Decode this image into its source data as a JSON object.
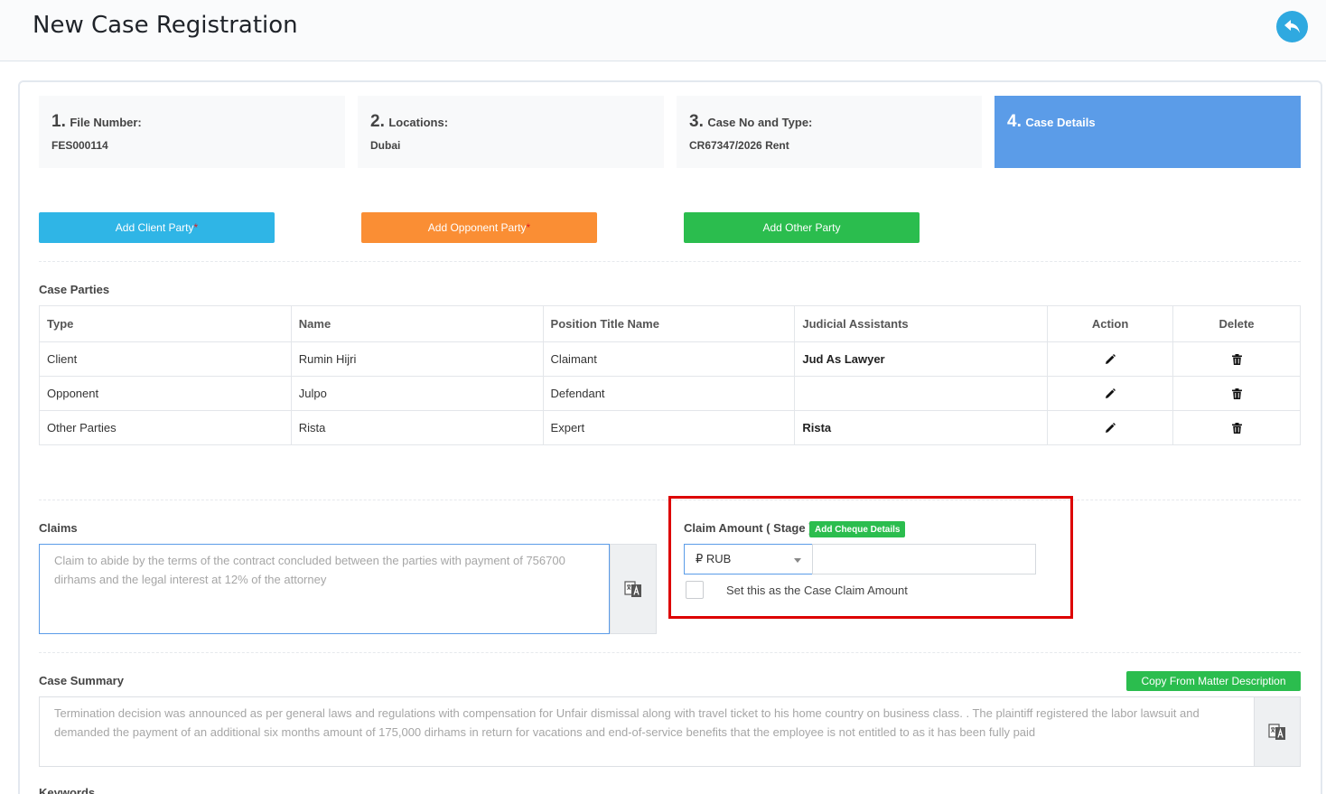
{
  "header": {
    "title": "New Case Registration",
    "back_icon": "reply-icon",
    "back_color": "#2fa9e0"
  },
  "steps": [
    {
      "number": "1.",
      "label": "File Number:",
      "value": "FES000114"
    },
    {
      "number": "2.",
      "label": "Locations:",
      "value": "Dubai"
    },
    {
      "number": "3.",
      "label": "Case No and Type:",
      "value": "CR67347/2026 Rent"
    },
    {
      "number": "4.",
      "label": "Case Details",
      "value": "",
      "active": true
    }
  ],
  "party_buttons": {
    "client": {
      "label": "Add Client Party",
      "required_mark": "*",
      "color": "#2fb5e6"
    },
    "opponent": {
      "label": "Add Opponent Party",
      "required_mark": "*",
      "color": "#fa8e34"
    },
    "other": {
      "label": "Add Other Party",
      "color": "#2bbd4e"
    }
  },
  "case_parties": {
    "title": "Case Parties",
    "columns": [
      "Type",
      "Name",
      "Position Title Name",
      "Judicial Assistants",
      "Action",
      "Delete"
    ],
    "rows": [
      {
        "type": "Client",
        "name": "Rumin Hijri",
        "position": "Claimant",
        "judicial": "Jud As Lawyer"
      },
      {
        "type": "Opponent",
        "name": "Julpo",
        "position": "Defendant",
        "judicial": ""
      },
      {
        "type": "Other Parties",
        "name": "Rista",
        "position": "Expert",
        "judicial": "Rista"
      }
    ],
    "action_icon": "pencil-icon",
    "delete_icon": "trash-icon"
  },
  "claims": {
    "label": "Claims",
    "text": "Claim to abide by the terms of the contract concluded between the parties with payment of 756700 dirhams and the legal interest at 12% of the attorney",
    "translate_icon": "translate-icon"
  },
  "claim_amount": {
    "label": "Claim Amount ( Stage )",
    "cheque_button": "Add Cheque Details",
    "currency": "₽ RUB",
    "amount": "",
    "checkbox_label": "Set this as the Case Claim Amount",
    "checked": false,
    "highlight_color": "#dd0000"
  },
  "case_summary": {
    "label": "Case Summary",
    "copy_button": "Copy From Matter Description",
    "text": "Termination decision was announced as per general laws and regulations with compensation for Unfair dismissal along with travel ticket to his home country on business class. . The plaintiff registered the labor lawsuit and demanded the payment of an additional six months amount of 175,000 dirhams in return for vacations and end-of-service benefits that the employee is not entitled to as it has been fully paid",
    "translate_icon": "translate-icon"
  },
  "keywords": {
    "label": "Keywords"
  }
}
